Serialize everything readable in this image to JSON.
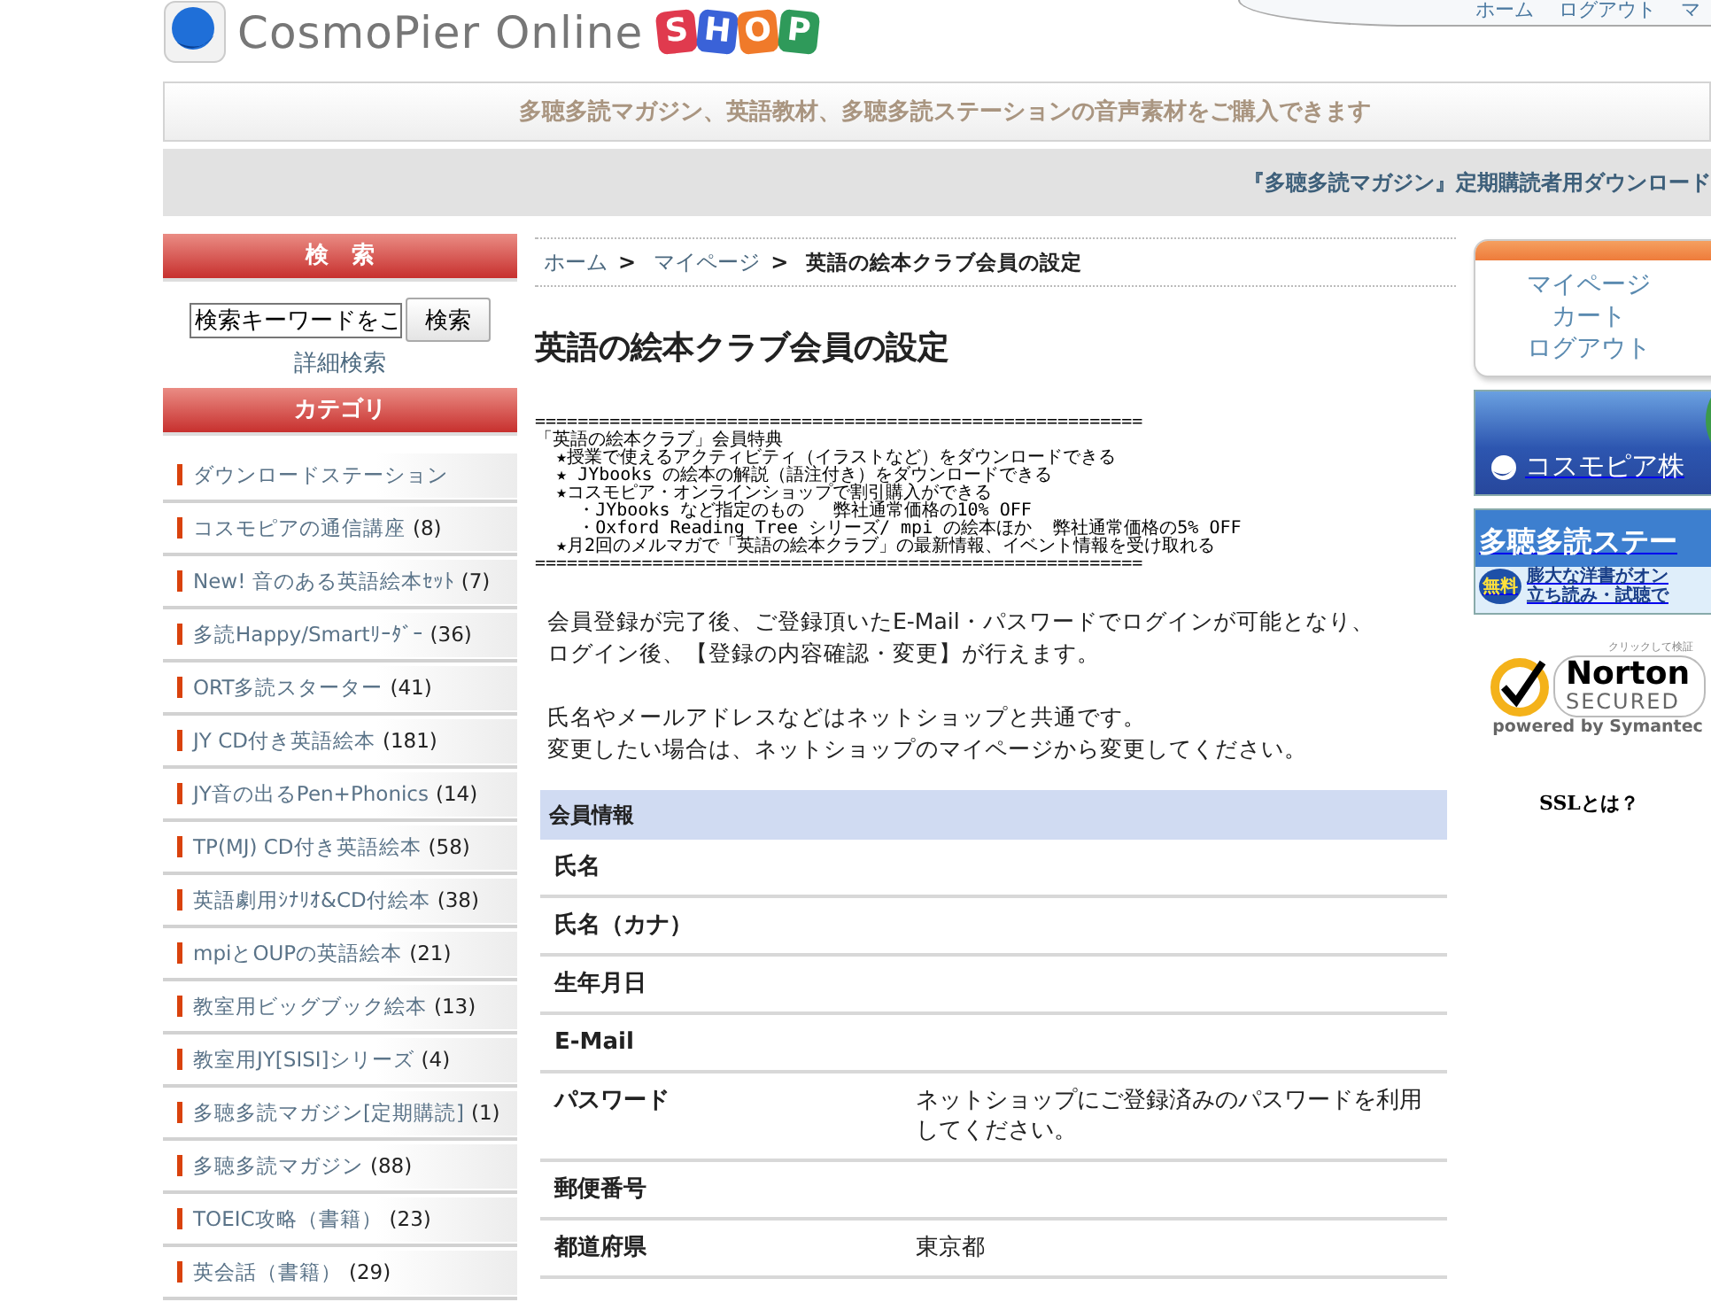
{
  "header": {
    "logo": {
      "text": "CosmoPier Online",
      "shop_letters": [
        {
          "letter": "S",
          "color": "#e03a4e"
        },
        {
          "letter": "H",
          "color": "#3a62d8"
        },
        {
          "letter": "O",
          "color": "#f07a2a"
        },
        {
          "letter": "P",
          "color": "#2f9a5a"
        }
      ]
    },
    "top_links": [
      "ホーム",
      "ログアウト",
      "マ"
    ]
  },
  "tagline": "多聴多読マガジン、英語教材、多聴多読ステーションの音声素材をご購入できます",
  "notice_link": "『多聴多読マガジン』定期購読者用ダウンロード",
  "sidebar": {
    "search": {
      "heading": "検　索",
      "value": "検索キーワードをこ",
      "button": "検索",
      "advanced_link": "詳細検索"
    },
    "categories": {
      "heading": "カテゴリ",
      "items": [
        {
          "name": "ダウンロードステーション"
        },
        {
          "name": "コスモピアの通信講座",
          "count": "(8)"
        },
        {
          "name": "New! 音のある英語絵本ｾｯﾄ",
          "count": "(7)"
        },
        {
          "name": "多読Happy/Smartﾘｰﾀﾞｰ",
          "count": "(36)"
        },
        {
          "name": "ORT多読スターター",
          "count": "(41)"
        },
        {
          "name": "JY CD付き英語絵本",
          "count": "(181)"
        },
        {
          "name": "JY音の出るPen+Phonics",
          "count": "(14)"
        },
        {
          "name": "TP(MJ) CD付き英語絵本",
          "count": "(58)"
        },
        {
          "name": "英語劇用ｼﾅﾘｵ&CD付絵本",
          "count": "(38)"
        },
        {
          "name": "mpiとOUPの英語絵本",
          "count": "(21)"
        },
        {
          "name": "教室用ビッグブック絵本",
          "count": "(13)"
        },
        {
          "name": "教室用JY[SISI]シリーズ",
          "count": "(4)"
        },
        {
          "name": "多聴多読マガジン[定期購読]",
          "count": "(1)"
        },
        {
          "name": "多聴多読マガジン",
          "count": "(88)"
        },
        {
          "name": "TOEIC攻略（書籍）",
          "count": "(23)"
        },
        {
          "name": "英会話（書籍）",
          "count": "(29)"
        }
      ]
    }
  },
  "main": {
    "breadcrumb": [
      {
        "label": "ホーム",
        "kind": "link",
        "separator": ">"
      },
      {
        "label": "マイページ",
        "kind": "link",
        "separator": ">"
      },
      {
        "label": "英語の絵本クラブ会員の設定",
        "kind": "current"
      }
    ],
    "title": "英語の絵本クラブ会員の設定",
    "perks": {
      "rule": "=========================================================",
      "lines": [
        "「英語の絵本クラブ」会員特典",
        "  ★授業で使えるアクティビティ（イラストなど）をダウンロードできる",
        "  ★ JYbooks の絵本の解説（語注付き）をダウンロードできる",
        "  ★コスモピア・オンラインショップで割引購入ができる",
        "    ・JYbooks など指定のもの　 弊社通常価格の10% OFF",
        "    ・Oxford Reading Tree シリーズ/ mpi の絵本ほか  弊社通常価格の5% OFF",
        "  ★月2回のメルマガで「英語の絵本クラブ」の最新情報、イベント情報を受け取れる"
      ]
    },
    "paragraphs": [
      [
        "会員登録が完了後、ご登録頂いたE-Mail・パスワードでログインが可能となり、",
        "ログイン後、【登録の内容確認・変更】が行えます。"
      ],
      [
        "氏名やメールアドレスなどはネットショップと共通です。",
        "変更したい場合は、ネットショップのマイページから変更してください。"
      ]
    ],
    "table": {
      "heading": "会員情報",
      "rows": [
        {
          "label": "氏名"
        },
        {
          "label": "氏名（カナ）"
        },
        {
          "label": "生年月日"
        },
        {
          "label": "E-Mail"
        },
        {
          "label": "パスワード",
          "value": "ネットショップにご登録済みのパスワードを利用してください。"
        },
        {
          "label": "郵便番号"
        },
        {
          "label": "都道府県",
          "value": "東京都"
        }
      ]
    }
  },
  "right": {
    "menu": [
      "マイページ",
      "カート",
      "ログアウト"
    ],
    "banners": [
      {
        "kind": "company",
        "text": "コスモピア株"
      },
      {
        "kind": "station",
        "title": "多聴多読ステー",
        "badge": "無料",
        "lines": [
          "膨大な洋書がオン",
          "立ち読み・試聴で"
        ]
      }
    ],
    "seal": {
      "note": "クリックして検証",
      "brand": "Norton",
      "label": "SECURED",
      "footer": "powered by Symantec"
    },
    "ssl_link": "SSLとは？"
  }
}
